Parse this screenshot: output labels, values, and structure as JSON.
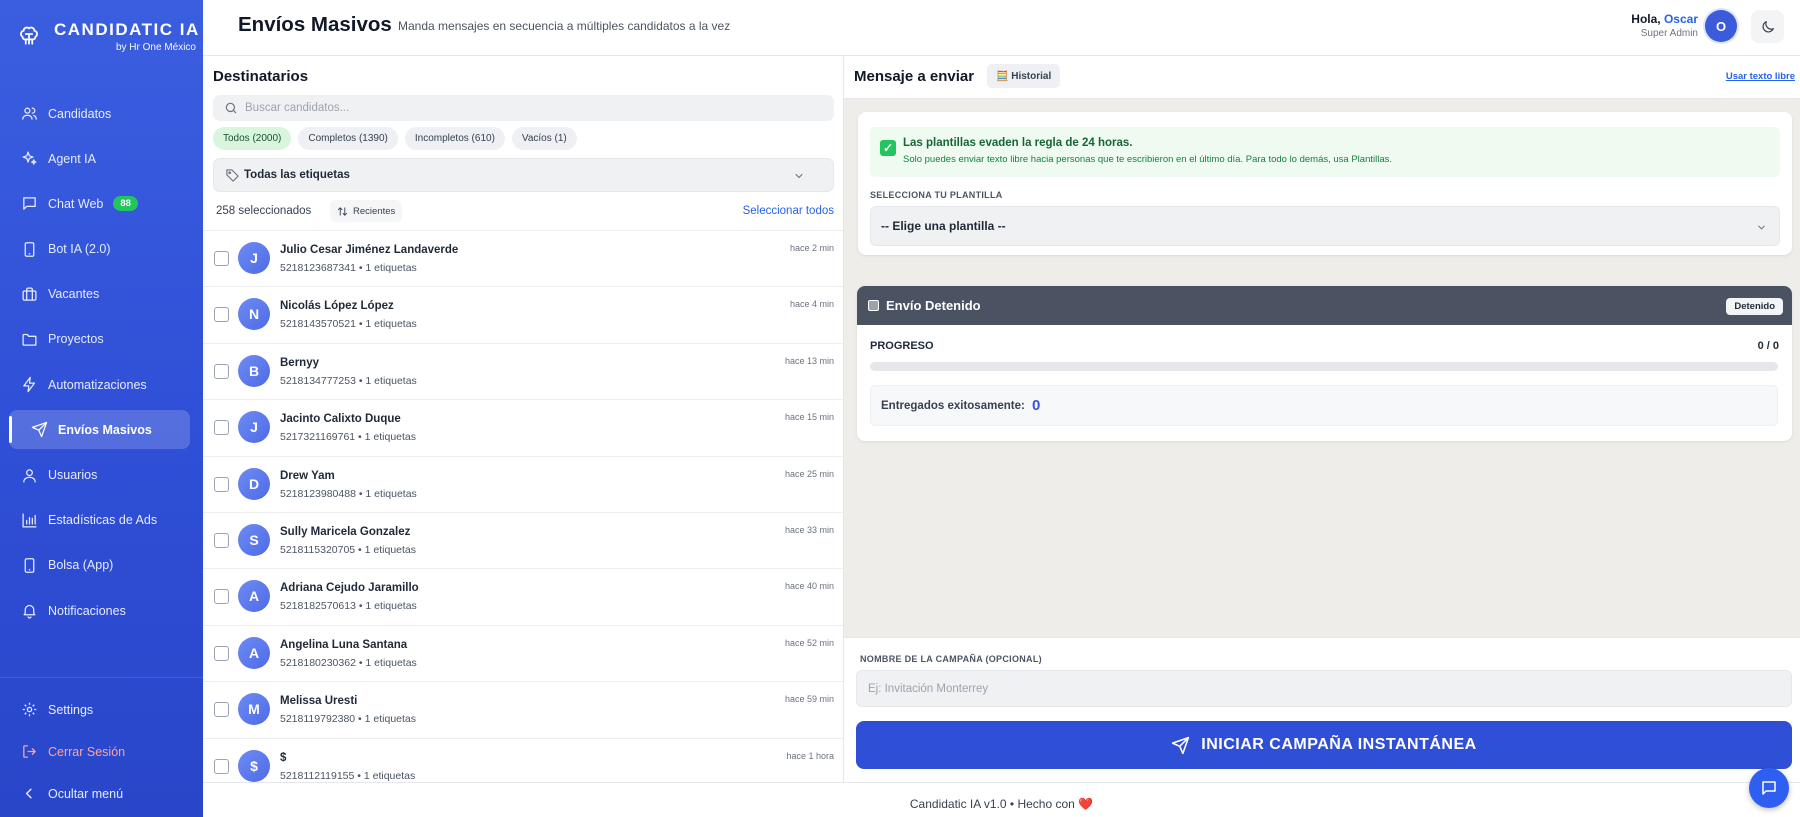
{
  "brand": {
    "name": "CANDIDATIC IA",
    "sub": "by Hr One México"
  },
  "sidebar": {
    "items": [
      {
        "label": "Candidatos",
        "icon": "users-icon"
      },
      {
        "label": "Agent IA",
        "icon": "sparkles-icon"
      },
      {
        "label": "Chat Web",
        "icon": "chat-icon",
        "badge": "88"
      },
      {
        "label": "Bot IA (2.0)",
        "icon": "smartphone-icon"
      },
      {
        "label": "Vacantes",
        "icon": "briefcase-icon"
      },
      {
        "label": "Proyectos",
        "icon": "folder-icon"
      },
      {
        "label": "Automatizaciones",
        "icon": "bolt-icon"
      },
      {
        "label": "Envíos Masivos",
        "icon": "send-icon",
        "active": true
      },
      {
        "label": "Usuarios",
        "icon": "user-icon"
      },
      {
        "label": "Estadísticas de Ads",
        "icon": "bar-chart-icon"
      },
      {
        "label": "Bolsa (App)",
        "icon": "smartphone-icon"
      },
      {
        "label": "Notificaciones",
        "icon": "bell-icon"
      }
    ],
    "settings": "Settings",
    "logout": "Cerrar Sesión",
    "hide_menu": "Ocultar menú"
  },
  "header": {
    "title": "Envíos Masivos",
    "subtitle": "Manda mensajes en secuencia a múltiples candidatos a la vez",
    "greeting_prefix": "Hola,",
    "user_name": "Oscar",
    "role": "Super Admin",
    "avatar_initial": "O"
  },
  "recipients": {
    "title": "Destinatarios",
    "search_placeholder": "Buscar candidatos...",
    "filters": [
      {
        "label": "Todos (2000)",
        "active": true
      },
      {
        "label": "Completos (1390)"
      },
      {
        "label": "Incompletos (610)"
      },
      {
        "label": "Vacíos (1)"
      }
    ],
    "tags_label": "Todas las etiquetas",
    "selected_count": "258 seleccionados",
    "sort_label": "Recientes",
    "select_all": "Seleccionar todos",
    "rows": [
      {
        "initial": "J",
        "name": "Julio Cesar Jiménez Landaverde",
        "meta": "5218123687341 • 1 etiquetas",
        "time": "hace 2 min"
      },
      {
        "initial": "N",
        "name": "Nicolás López López",
        "meta": "5218143570521 • 1 etiquetas",
        "time": "hace 4 min"
      },
      {
        "initial": "B",
        "name": "Bernyy",
        "meta": "5218134777253 • 1 etiquetas",
        "time": "hace 13 min"
      },
      {
        "initial": "J",
        "name": "Jacinto Calixto Duque",
        "meta": "5217321169761 • 1 etiquetas",
        "time": "hace 15 min"
      },
      {
        "initial": "D",
        "name": "Drew Yam",
        "meta": "5218123980488 • 1 etiquetas",
        "time": "hace 25 min"
      },
      {
        "initial": "S",
        "name": "Sully Maricela Gonzalez",
        "meta": "5218115320705 • 1 etiquetas",
        "time": "hace 33 min"
      },
      {
        "initial": "A",
        "name": "Adriana Cejudo Jaramillo",
        "meta": "5218182570613 • 1 etiquetas",
        "time": "hace 40 min"
      },
      {
        "initial": "A",
        "name": "Angelina Luna Santana",
        "meta": "5218180230362 • 1 etiquetas",
        "time": "hace 52 min"
      },
      {
        "initial": "M",
        "name": "Melissa Uresti",
        "meta": "5218119792380 • 1 etiquetas",
        "time": "hace 59 min"
      },
      {
        "initial": "$",
        "name": "$",
        "meta": "5218112119155 • 1 etiquetas",
        "time": "hace 1 hora"
      }
    ]
  },
  "message": {
    "title": "Mensaje a enviar",
    "history_label": "🧮 Historial",
    "free_text_link": "Usar texto libre",
    "notice_title": "Las plantillas evaden la regla de 24 horas.",
    "notice_sub": "Solo puedes enviar texto libre hacia personas que te escribieron en el último día. Para todo lo demás, usa Plantillas.",
    "template_label": "SELECCIONA TU PLANTILLA",
    "template_value": "-- Elige una plantilla --"
  },
  "status": {
    "title": "Envío Detenido",
    "badge": "Detenido",
    "progress_label": "PROGRESO",
    "progress_value": "0 / 0",
    "progress_fraction": 0,
    "delivered_label": "Entregados exitosamente:",
    "delivered_value": "0"
  },
  "campaign": {
    "name_label": "NOMBRE DE LA CAMPAÑA (OPCIONAL)",
    "name_placeholder": "Ej: Invitación Monterrey",
    "start_label": "INICIAR CAMPAÑA INSTANTÁNEA"
  },
  "footer": {
    "text": "Candidatic IA v1.0 • Hecho con ❤️"
  },
  "colors": {
    "sidebar": "#3157dc",
    "accent": "#2f4fd6",
    "success": "#22c55e",
    "status_bar": "#4b5262"
  }
}
